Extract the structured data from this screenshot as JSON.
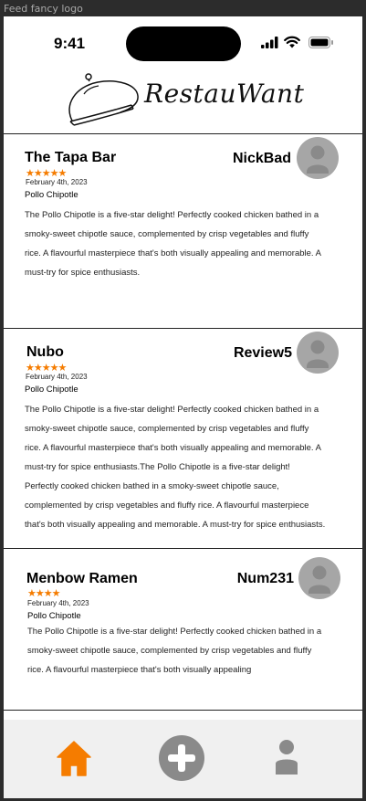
{
  "frame": {
    "label": "Feed fancy logo"
  },
  "status_bar": {
    "time": "9:41"
  },
  "header": {
    "brand": "RestauWant"
  },
  "reviews": [
    {
      "restaurant": "The Tapa Bar",
      "rating": 5,
      "stars": "★★★★★",
      "date": "February 4th, 2023",
      "dish": "Pollo Chipotle",
      "username": "NickBad",
      "lines": [
        "The Pollo Chipotle is a five-star delight! Perfectly cooked chicken bathed in a",
        "smoky-sweet chipotle sauce, complemented by crisp vegetables and fluffy",
        "rice. A flavourful masterpiece that's both visually appealing and memorable. A",
        "must-try for spice enthusiasts."
      ]
    },
    {
      "restaurant": "Nubo",
      "rating": 5,
      "stars": "★★★★★",
      "date": "February 4th, 2023",
      "dish": "Pollo Chipotle",
      "username": "Review5",
      "lines": [
        "The Pollo Chipotle is a five-star delight! Perfectly cooked chicken bathed in a",
        "smoky-sweet chipotle sauce, complemented by crisp vegetables and fluffy",
        "rice. A flavourful masterpiece that's both visually appealing and memorable. A",
        "must-try for spice enthusiasts.The Pollo Chipotle is a five-star delight!",
        "Perfectly cooked chicken bathed in a smoky-sweet chipotle sauce,",
        "complemented by crisp vegetables and fluffy rice. A flavourful masterpiece",
        "that's both visually appealing and memorable. A must-try for spice enthusiasts."
      ]
    },
    {
      "restaurant": "Menbow Ramen",
      "rating": 4,
      "stars": "★★★★",
      "date": "February 4th, 2023",
      "dish": "Pollo Chipotle",
      "username": "Num231",
      "lines": [
        "The Pollo Chipotle is a five-star delight! Perfectly cooked chicken bathed in a",
        "smoky-sweet chipotle sauce, complemented by crisp vegetables and fluffy",
        "rice. A flavourful masterpiece that's both visually appealing"
      ]
    }
  ],
  "bottom_nav": {
    "items": [
      {
        "icon": "home-icon",
        "color": "#f57c00"
      },
      {
        "icon": "add-icon",
        "color": "#8a8a8a"
      },
      {
        "icon": "profile-icon",
        "color": "#8a8a8a"
      }
    ]
  },
  "colors": {
    "accent": "#f57c00",
    "avatar": "#a6a6a6",
    "nav_bg": "#f0f0f0"
  }
}
